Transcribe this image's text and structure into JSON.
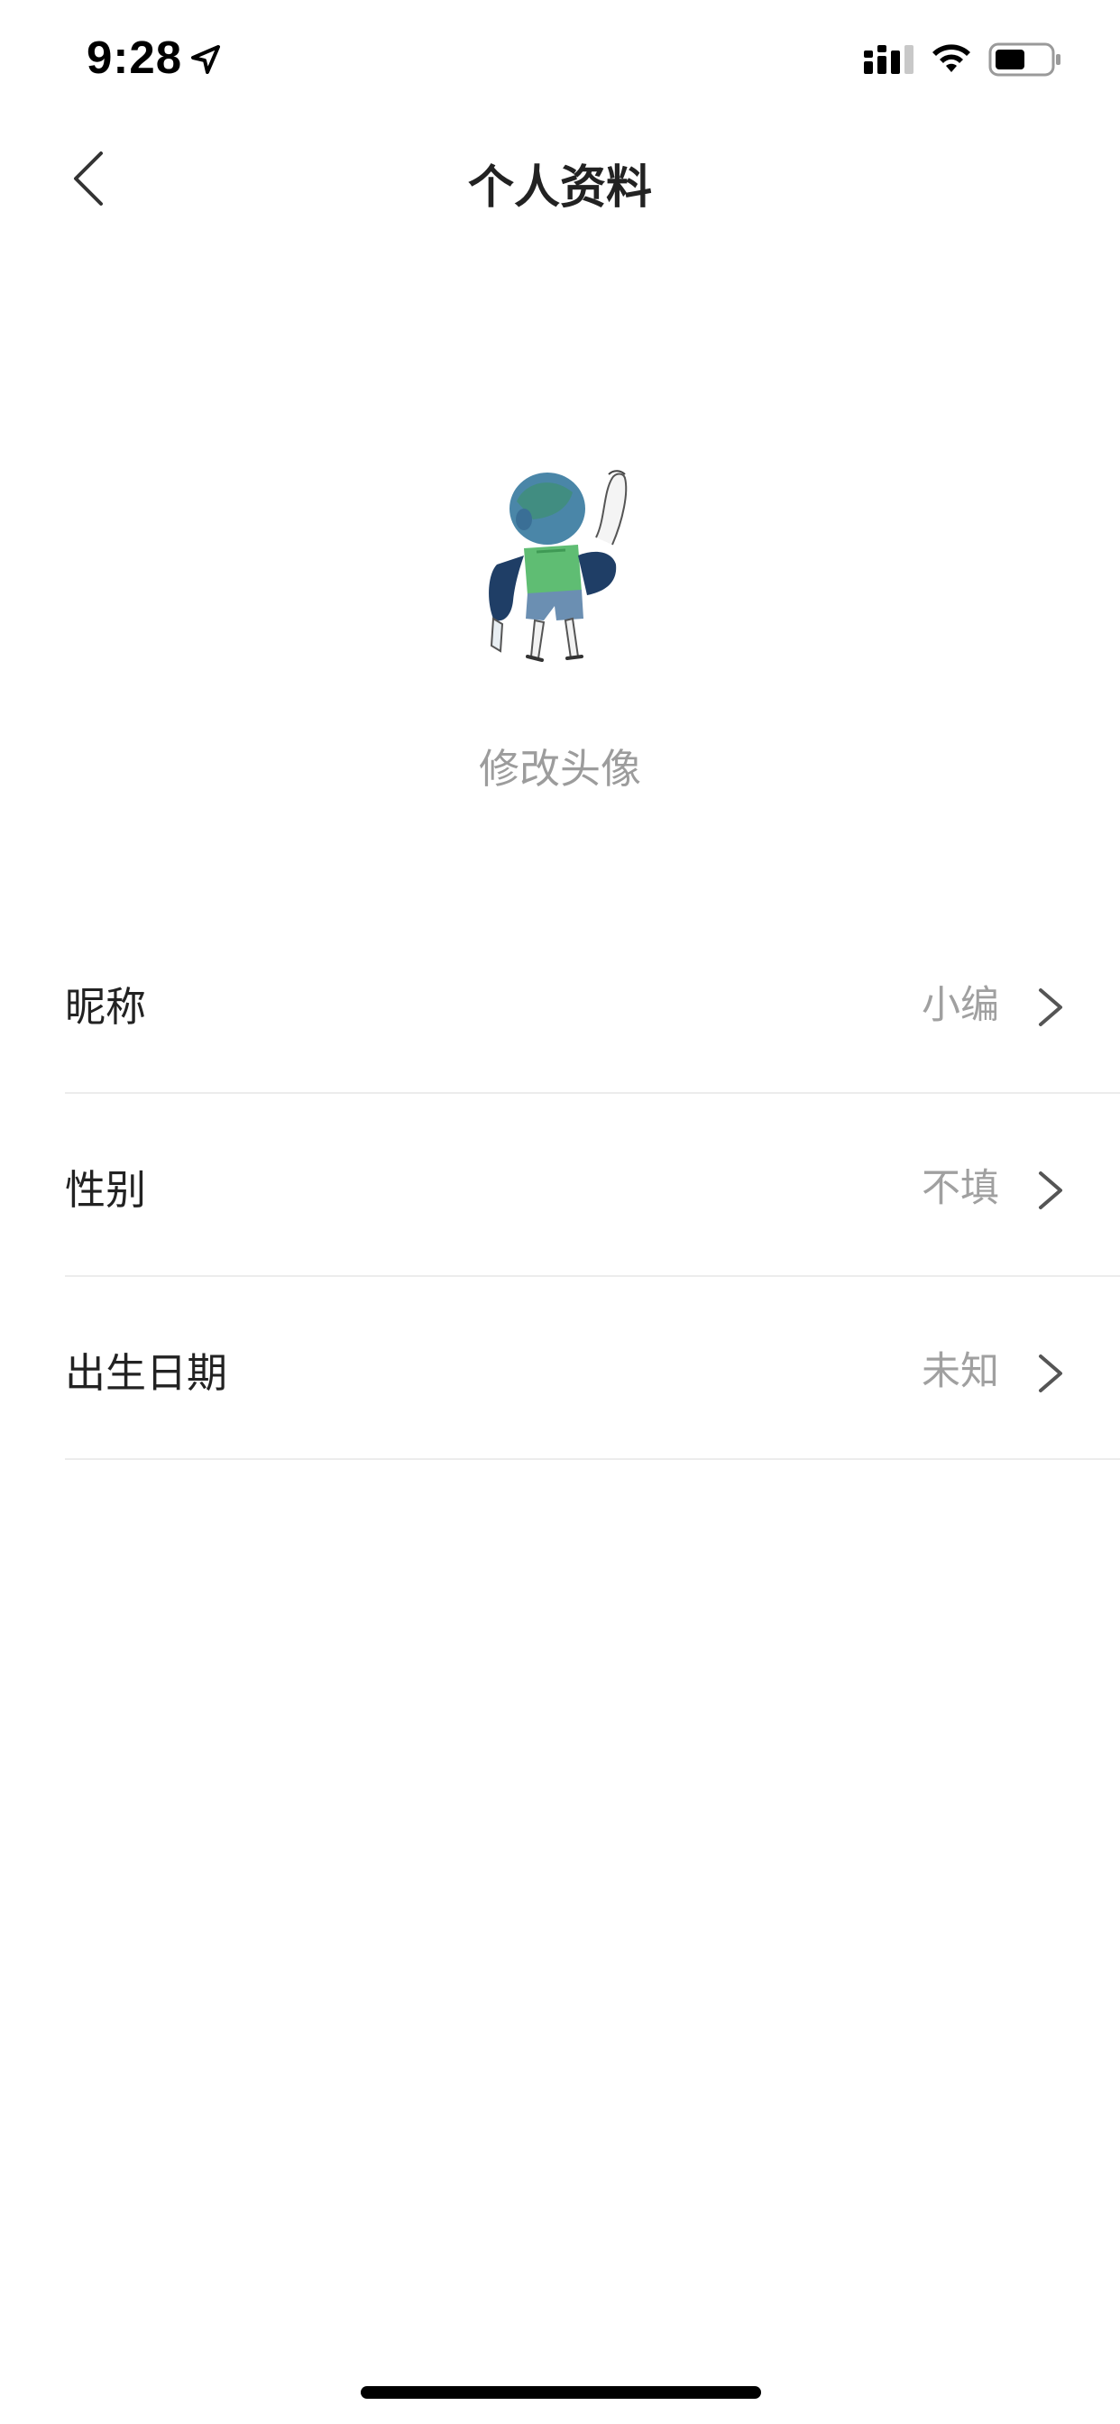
{
  "status_bar": {
    "time": "9:28",
    "icons": [
      "location-icon",
      "signal-icon",
      "wifi-icon",
      "battery-icon"
    ]
  },
  "nav": {
    "title": "个人资料",
    "back_icon": "chevron-left-icon"
  },
  "avatar": {
    "change_label": "修改头像"
  },
  "settings": {
    "items": [
      {
        "label": "昵称",
        "value": "小编"
      },
      {
        "label": "性别",
        "value": "不填"
      },
      {
        "label": "出生日期",
        "value": "未知"
      }
    ]
  },
  "colors": {
    "text_primary": "#222222",
    "text_secondary": "#9c9c9c",
    "divider": "#ececec",
    "background": "#ffffff"
  }
}
